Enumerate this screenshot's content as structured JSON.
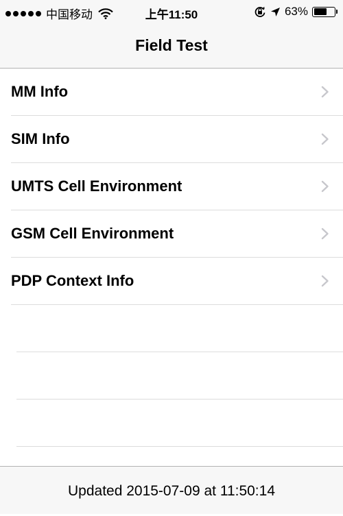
{
  "status_bar": {
    "signal_bars": 5,
    "carrier": "中国移动",
    "time": "上午11:50",
    "battery_text": "63%",
    "battery_level": 0.63
  },
  "nav": {
    "title": "Field Test"
  },
  "menu": [
    {
      "label": "MM Info"
    },
    {
      "label": "SIM Info"
    },
    {
      "label": "UMTS Cell Environment"
    },
    {
      "label": "GSM Cell Environment"
    },
    {
      "label": "PDP Context Info"
    }
  ],
  "footer": {
    "updated": "Updated 2015-07-09 at 11:50:14"
  },
  "icons": [
    "signal-dots-icon",
    "wifi-icon",
    "rotation-lock-icon",
    "location-arrow-icon",
    "battery-icon",
    "chevron-right-icon"
  ]
}
